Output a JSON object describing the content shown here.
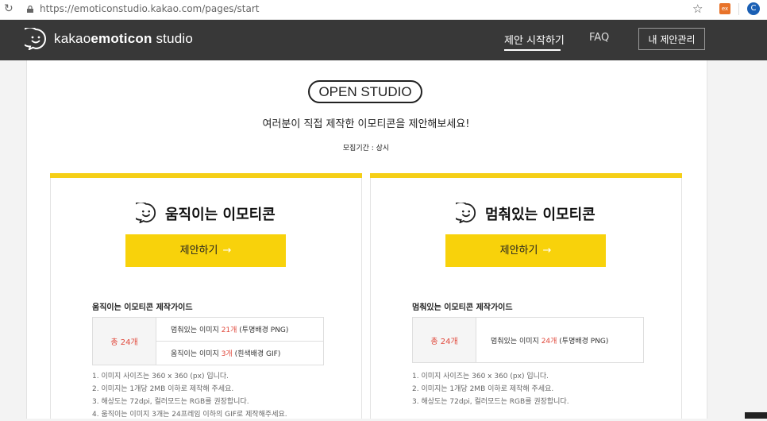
{
  "browser": {
    "url": "https://emoticonstudio.kakao.com/pages/start",
    "extension_label": "ex",
    "profile_initial": "C"
  },
  "header": {
    "brand_prefix": "kakao",
    "brand_bold": "emoticon",
    "brand_suffix": " studio",
    "nav_start": "제안 시작하기",
    "nav_faq": "FAQ",
    "manage_button": "내 제안관리"
  },
  "intro": {
    "badge": "OPEN STUDIO",
    "subtitle": "여러분이 직접 제작한 이모티콘을 제안해보세요!",
    "period": "모집기간 : 상시"
  },
  "cards": [
    {
      "title": "움직이는 이모티콘",
      "cta": "제안하기",
      "guide_title": "움직이는 이모티콘 제작가이드",
      "total": "총 24개",
      "rows": [
        {
          "pre": "멈춰있는 이미지 ",
          "count": "21개",
          "post": " (투명배경 PNG)"
        },
        {
          "pre": "움직이는 이미지 ",
          "count": "3개",
          "post": " (흰색배경 GIF)"
        }
      ],
      "notes": [
        "1. 이미지 사이즈는 360 x 360 (px) 입니다.",
        "2. 이미지는 1개당 2MB 이하로 제작해 주세요.",
        "3. 해상도는 72dpi, 컬러모드는 RGB를 권장합니다.",
        "4. 움직이는 이미지 3개는 24프레임 이하의 GIF로 제작해주세요."
      ]
    },
    {
      "title": "멈춰있는 이모티콘",
      "cta": "제안하기",
      "guide_title": "멈춰있는 이모티콘 제작가이드",
      "total": "총 24개",
      "rows": [
        {
          "pre": "멈춰있는 이미지 ",
          "count": "24개",
          "post": " (투명배경 PNG)"
        }
      ],
      "notes": [
        "1. 이미지 사이즈는 360 x 360 (px) 입니다.",
        "2. 이미지는 1개당 2MB 이하로 제작해 주세요.",
        "3. 해상도는 72dpi, 컬러모드는 RGB를 권장합니다."
      ]
    }
  ],
  "icons": {
    "reload": "reload-icon",
    "lock": "lock-icon",
    "star": "bookmark-star-icon",
    "logo": "speech-bubble-smile-icon"
  },
  "colors": {
    "header_bg": "#383838",
    "accent_yellow": "#f8d20b",
    "highlight_red": "#e0483b"
  }
}
